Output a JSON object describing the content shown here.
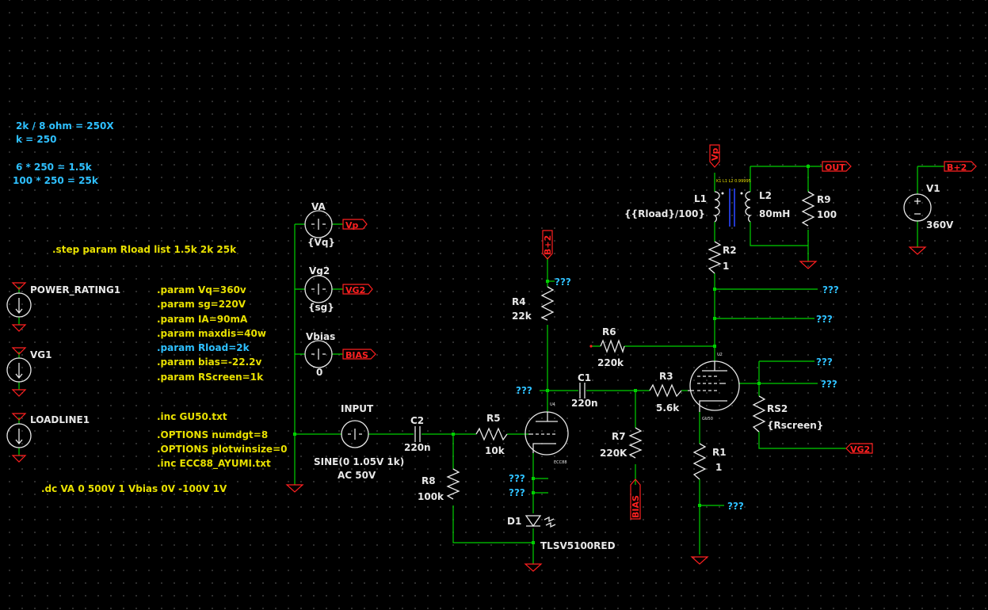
{
  "notes": {
    "turns_ratio": "2k / 8 ohm = 250X",
    "k": "k = 250",
    "calc1": "6 * 250 = 1.5k",
    "calc2": "100 * 250 = 25k",
    "step": ".step param Rload list 1.5k 2k 25k",
    "dc": ".dc VA 0 500V 1 Vbias 0V -100V 1V"
  },
  "params": [
    ".param Vq=360v",
    ".param sg=220V",
    ".param IA=90mA",
    ".param maxdis=40w",
    ".param Rload=2k",
    ".param bias=-22.2v",
    ".param RScreen=1k"
  ],
  "directives": [
    ".inc GU50.txt",
    ".OPTIONS numdgt=8",
    ".OPTIONS plotwinsize=0",
    ".inc ECC88_AYUMI.txt"
  ],
  "sources": {
    "power_rating": "POWER_RATING1",
    "vg1": "VG1",
    "loadline": "LOADLINE1",
    "va": {
      "name": "VA",
      "value": "{Vq}"
    },
    "vg2": {
      "name": "Vg2",
      "value": "{sg}"
    },
    "vbias": {
      "name": "Vbias",
      "value": "0"
    },
    "input": {
      "name": "INPUT",
      "value1": "SINE(0 1.05V 1k)",
      "value2": "AC 50V"
    },
    "v1": {
      "name": "V1",
      "value": "360V"
    }
  },
  "components": {
    "c2": {
      "name": "C2",
      "value": "220n"
    },
    "r5": {
      "name": "R5",
      "value": "10k"
    },
    "r8": {
      "name": "R8",
      "value": "100k"
    },
    "r4": {
      "name": "R4",
      "value": "22k"
    },
    "r6": {
      "name": "R6",
      "value": "220k"
    },
    "c1": {
      "name": "C1",
      "value": "220n"
    },
    "r3": {
      "name": "R3",
      "value": "5.6k"
    },
    "r7": {
      "name": "R7",
      "value": "220K"
    },
    "d1": {
      "name": "D1",
      "value": "TLSV5100RED"
    },
    "l1": {
      "name": "L1",
      "value": "{{Rload}/100}"
    },
    "l2": {
      "name": "L2",
      "value": "80mH"
    },
    "r9": {
      "name": "R9",
      "value": "100"
    },
    "r2": {
      "name": "R2",
      "value": "1"
    },
    "r1": {
      "name": "R1",
      "value": "1"
    },
    "rs2": {
      "name": "RS2",
      "value": "{Rscreen}"
    },
    "coupling": "K1 L1 L2 0.99995",
    "u4": "U4",
    "u4_model": "ECC88",
    "u2": "U2",
    "u2_model": "GU50"
  },
  "nets": {
    "vp": "Vp",
    "vg2": "VG2",
    "bias": "BIAS",
    "bplus": "B+2",
    "out": "OUT",
    "unknown": "???"
  },
  "colors": {
    "wire": "#00d000",
    "component": "#e8e8e8",
    "netlabel": "#ff2020",
    "param": "#e8e000",
    "comment": "#2ec0ff",
    "background": "#000000"
  }
}
